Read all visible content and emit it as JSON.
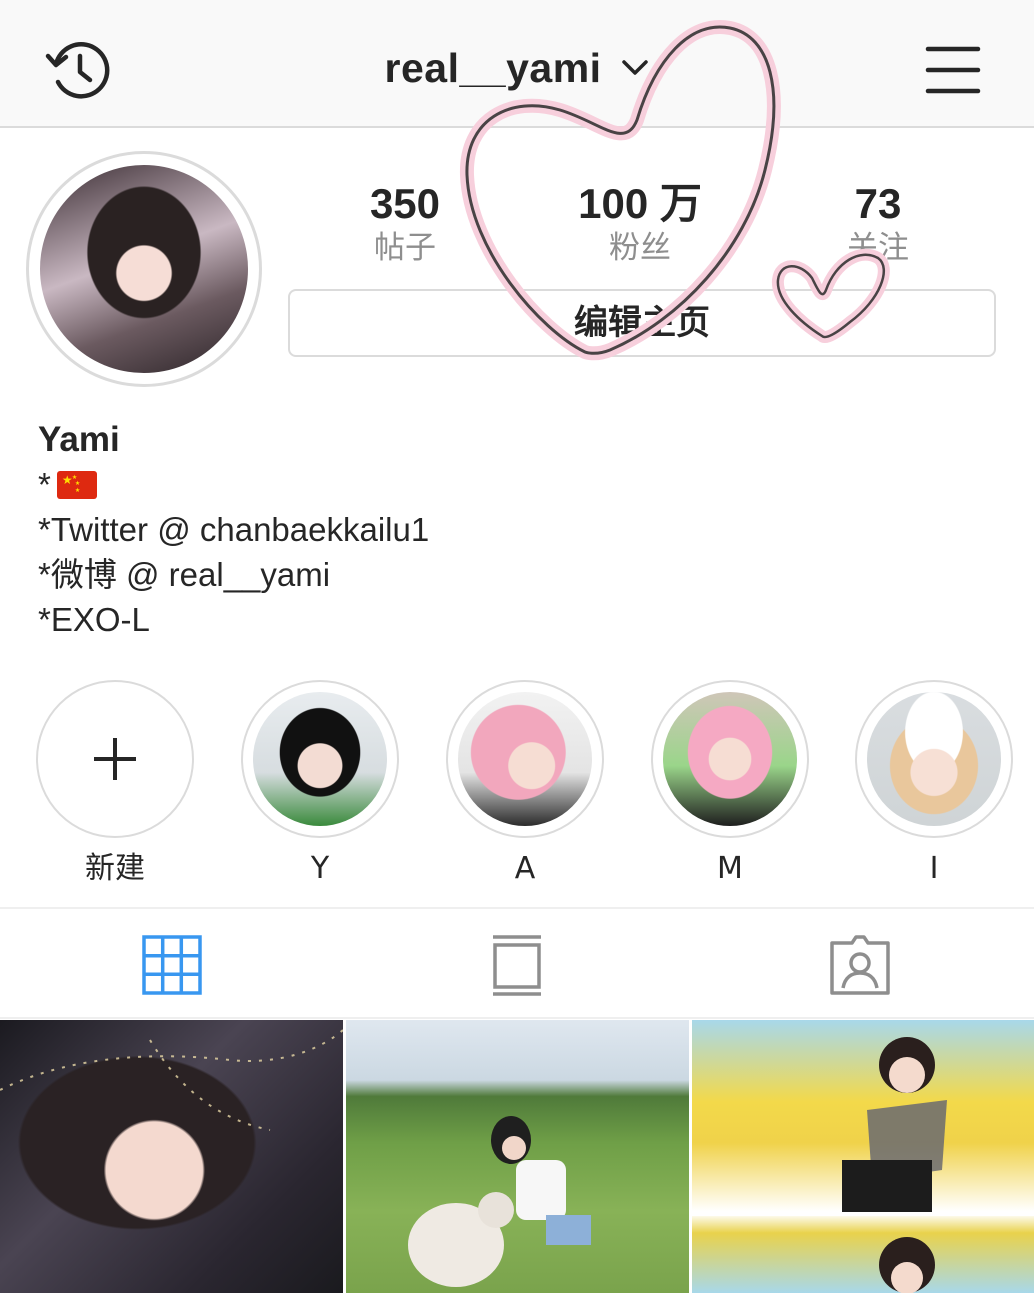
{
  "header": {
    "username": "real__yami",
    "icons": [
      "history-icon",
      "chevron-down-icon",
      "hamburger-menu-icon"
    ]
  },
  "stats": {
    "posts": {
      "value": "350",
      "label": "帖子"
    },
    "followers": {
      "value": "100 万",
      "label": "粉丝"
    },
    "following": {
      "value": "73",
      "label": "关注"
    }
  },
  "edit_profile_label": "编辑主页",
  "bio": {
    "name": "Yami",
    "line1": "*",
    "line2": "*Twitter @ chanbaekkailu1",
    "line3": "*微博 @ real__yami",
    "line4": "*EXO-L"
  },
  "highlights": [
    {
      "label": "新建"
    },
    {
      "label": "Y"
    },
    {
      "label": "A"
    },
    {
      "label": "M"
    },
    {
      "label": "I"
    }
  ],
  "tabs": {
    "active_color": "#3897f0",
    "inactive_color": "#8e8e8e",
    "items": [
      "grid-icon",
      "feed-icon",
      "tagged-icon"
    ]
  },
  "colors": {
    "doodle": "#f7cfdc",
    "border": "#dbdbdb",
    "text": "#262626",
    "muted": "#8e8e8e"
  }
}
